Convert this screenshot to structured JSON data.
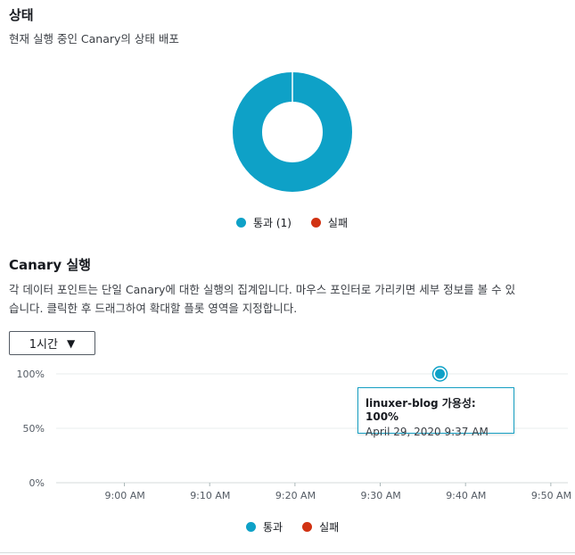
{
  "status": {
    "title": "상태",
    "description": "현재 실행 중인 Canary의 상태 배포",
    "legend": [
      {
        "label": "통과 (1)",
        "color": "#0ea1c7"
      },
      {
        "label": "실패",
        "color": "#d13212"
      }
    ]
  },
  "runs": {
    "title": "Canary 실행",
    "description_line1": "각 데이터 포인트는 단일 Canary에 대한 실행의 집계입니다. 마우스 포인터로 가리키면 세부 정보를 볼 수 있",
    "description_line2": "습니다. 클릭한 후 드래그하여 확대할 플롯 영역을 지정합니다.",
    "time_select": "1시간",
    "tooltip": {
      "title": "linuxer-blog 가용성: 100%",
      "time": "April 29, 2020 9:37 AM"
    },
    "legend": [
      {
        "label": "통과",
        "color": "#0ea1c7"
      },
      {
        "label": "실패",
        "color": "#d13212"
      }
    ]
  },
  "chart_data": [
    {
      "type": "pie",
      "subtype": "donut",
      "categories": [
        "통과",
        "실패"
      ],
      "values": [
        1,
        0
      ],
      "colors": [
        "#0ea1c7",
        "#d13212"
      ]
    },
    {
      "type": "scatter",
      "x_ticks": [
        "9:00 AM",
        "9:10 AM",
        "9:20 AM",
        "9:30 AM",
        "9:40 AM",
        "9:50 AM"
      ],
      "y_ticks": [
        "100%",
        "50%",
        "0%"
      ],
      "ylim": [
        0,
        100
      ],
      "xlim_minutes_since_9am": [
        -8,
        52
      ],
      "series": [
        {
          "name": "통과",
          "color": "#0ea1c7",
          "points": [
            {
              "x": "9:37 AM",
              "y": 100
            }
          ]
        },
        {
          "name": "실패",
          "color": "#d13212",
          "points": []
        }
      ],
      "grid": true
    }
  ]
}
